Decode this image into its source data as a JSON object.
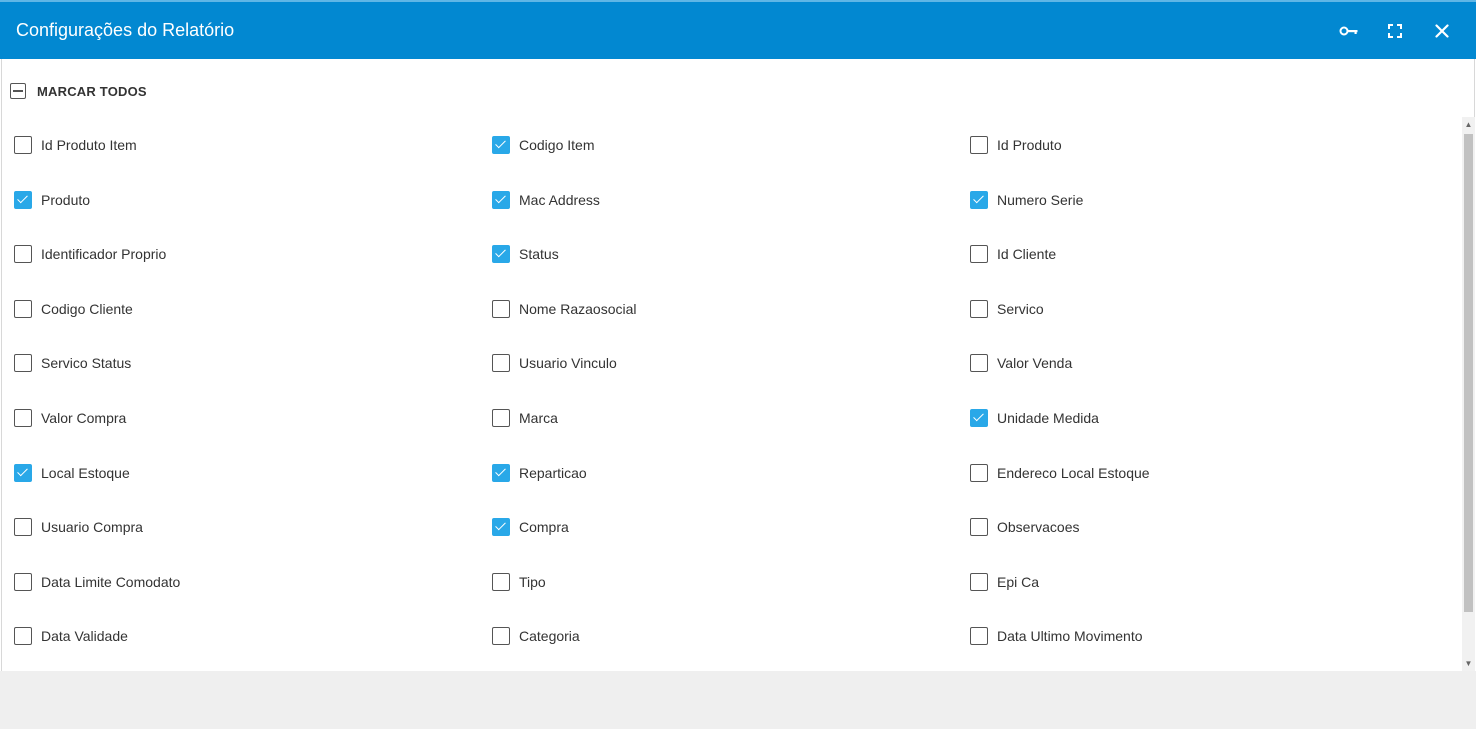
{
  "dialog": {
    "title": "Configurações do Relatório",
    "colors": {
      "header": "#0288d1",
      "checkbox_checked": "#29a8e8"
    },
    "actions": [
      {
        "name": "key-icon"
      },
      {
        "name": "fullscreen-icon"
      },
      {
        "name": "close-icon"
      }
    ]
  },
  "check_all": {
    "label": "MARCAR TODOS",
    "state": "indeterminate"
  },
  "columns": [
    [
      {
        "label": "Id Produto Item",
        "checked": false
      },
      {
        "label": "Produto",
        "checked": true
      },
      {
        "label": "Identificador Proprio",
        "checked": false
      },
      {
        "label": "Codigo Cliente",
        "checked": false
      },
      {
        "label": "Servico Status",
        "checked": false
      },
      {
        "label": "Valor Compra",
        "checked": false
      },
      {
        "label": "Local Estoque",
        "checked": true
      },
      {
        "label": "Usuario Compra",
        "checked": false
      },
      {
        "label": "Data Limite Comodato",
        "checked": false
      },
      {
        "label": "Data Validade",
        "checked": false
      }
    ],
    [
      {
        "label": "Codigo Item",
        "checked": true
      },
      {
        "label": "Mac Address",
        "checked": true
      },
      {
        "label": "Status",
        "checked": true
      },
      {
        "label": "Nome Razaosocial",
        "checked": false
      },
      {
        "label": "Usuario Vinculo",
        "checked": false
      },
      {
        "label": "Marca",
        "checked": false
      },
      {
        "label": "Reparticao",
        "checked": true
      },
      {
        "label": "Compra",
        "checked": true
      },
      {
        "label": "Tipo",
        "checked": false
      },
      {
        "label": "Categoria",
        "checked": false
      }
    ],
    [
      {
        "label": "Id Produto",
        "checked": false
      },
      {
        "label": "Numero Serie",
        "checked": true
      },
      {
        "label": "Id Cliente",
        "checked": false
      },
      {
        "label": "Servico",
        "checked": false
      },
      {
        "label": "Valor Venda",
        "checked": false
      },
      {
        "label": "Unidade Medida",
        "checked": true
      },
      {
        "label": "Endereco Local Estoque",
        "checked": false
      },
      {
        "label": "Observacoes",
        "checked": false
      },
      {
        "label": "Epi Ca",
        "checked": false
      },
      {
        "label": "Data Ultimo Movimento",
        "checked": false
      }
    ]
  ]
}
